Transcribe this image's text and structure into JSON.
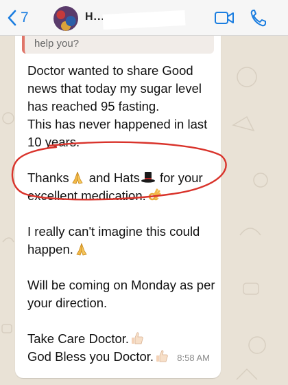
{
  "header": {
    "back_count": "7",
    "contact_name": "H...",
    "colors": {
      "accent": "#1a7de0",
      "header_bg": "#f6f6f6"
    },
    "icons": [
      "chevron-left-icon",
      "video-call-icon",
      "phone-call-icon"
    ]
  },
  "chat": {
    "background_color": "#e9e2d6",
    "quoted_reply": {
      "text": "help you?",
      "bar_color": "#e0766a"
    },
    "message": {
      "paragraphs": [
        [
          "Doctor wanted to share Good",
          "news that today my sugar level",
          "has reached 95 fasting.",
          "This has never happened in last",
          "10 years."
        ],
        [
          "Thanks",
          " and Hats",
          " for your",
          "excellent medication."
        ],
        [
          "I really can't imagine this could",
          "happen."
        ],
        [
          "Will be coming on Monday as per",
          "your direction."
        ],
        [
          "Take Care Doctor.",
          "God Bless you Doctor."
        ]
      ],
      "emojis": [
        "folded-hands-emoji",
        "top-hat-emoji",
        "ok-hand-emoji",
        "folded-hands-emoji",
        "thumbs-up-emoji",
        "thumbs-up-emoji"
      ],
      "timestamp": "8:58 AM",
      "highlight": {
        "type": "hand-drawn-ellipse",
        "color": "#d9332b"
      }
    }
  }
}
